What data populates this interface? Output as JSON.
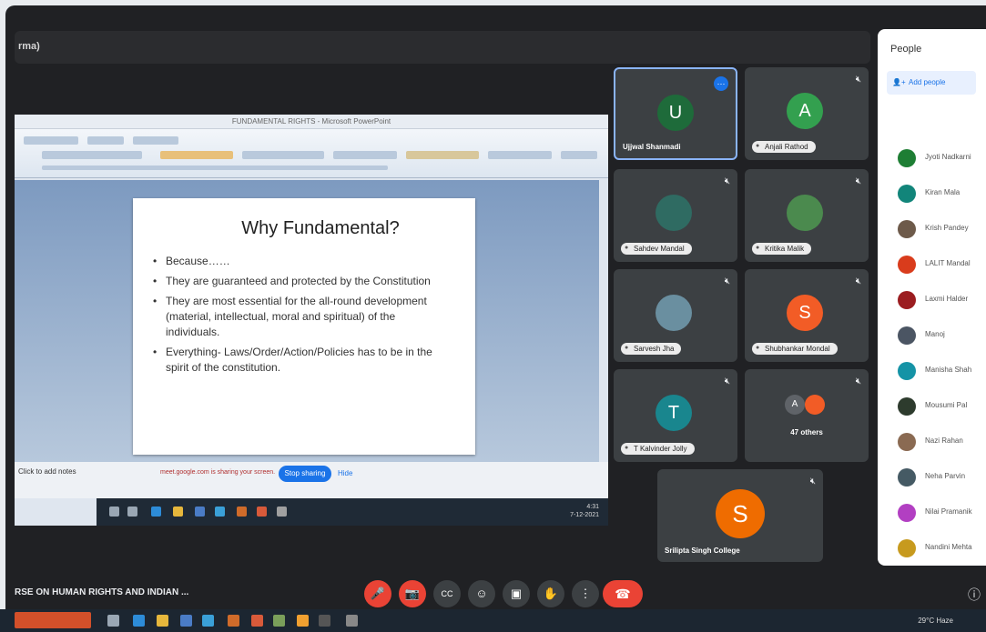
{
  "meeting": {
    "top_label": "rma)",
    "title": "RSE ON HUMAN RIGHTS AND INDIAN ..."
  },
  "shared_screen": {
    "window_title": "FUNDAMENTAL RIGHTS - Microsoft PowerPoint",
    "slide": {
      "title": "Why Fundamental?",
      "bullets": [
        "Because……",
        "They are guaranteed and protected by the Constitution",
        "They are most essential for the all-round development (material, intellectual, moral and spiritual) of the individuals.",
        "Everything- Laws/Order/Action/Policies has to be in the spirit of the constitution."
      ]
    },
    "status_label": "Click to add notes",
    "share_notice": "meet.google.com is sharing your screen.",
    "stop_sharing_label": "Stop sharing",
    "hide_label": "Hide",
    "clock": [
      "4:31",
      "7-12-2021"
    ]
  },
  "tiles": [
    {
      "initial": "U",
      "name": "Ujjwal Shanmadi",
      "color": "#1e6b3a",
      "active": true,
      "style": "plain"
    },
    {
      "initial": "A",
      "name": "Anjali Rathod",
      "color": "#33a04f",
      "style": "chip"
    },
    {
      "initial": "",
      "name": "Sahdev Mandal",
      "color": "#2f6b62",
      "style": "chip",
      "photo": true
    },
    {
      "initial": "",
      "name": "Kritika Malik",
      "color": "#4b8a4e",
      "style": "chip",
      "photo": true
    },
    {
      "initial": "",
      "name": "Sarvesh Jha",
      "color": "#6a8fa0",
      "style": "chip",
      "photo": true
    },
    {
      "initial": "S",
      "name": "Shubhankar Mondal",
      "color": "#f25c26",
      "style": "chip"
    },
    {
      "initial": "T",
      "name": "T Kalvinder Jolly",
      "color": "#19868e",
      "style": "chip"
    },
    {
      "initial": "A",
      "name": "47 others",
      "color": "#5f6368",
      "style": "others"
    },
    {
      "initial": "S",
      "name": "Srilipta Singh College",
      "color": "#ef6c00",
      "style": "plain"
    }
  ],
  "people_panel": {
    "title": "People",
    "add_label": "Add people",
    "list": [
      {
        "name": "Jyoti Nadkarni",
        "color": "#1e7e34"
      },
      {
        "name": "Kiran Mala",
        "color": "#12857a"
      },
      {
        "name": "Krish Pandey",
        "color": "#6d5a4a"
      },
      {
        "name": "LALIT Mandal",
        "color": "#d93c1c"
      },
      {
        "name": "Laxmi Halder",
        "color": "#9b1d20"
      },
      {
        "name": "Manoj",
        "color": "#4b5563"
      },
      {
        "name": "Manisha Shah",
        "color": "#1593a6"
      },
      {
        "name": "Mousumi Pal",
        "color": "#2d3b2d"
      },
      {
        "name": "Nazi Rahan",
        "color": "#8a6a52"
      },
      {
        "name": "Neha Parvin",
        "color": "#455a64"
      },
      {
        "name": "Nilai Pramanik",
        "color": "#b23fc2"
      },
      {
        "name": "Nandini Mehta",
        "color": "#c79a1e"
      }
    ]
  },
  "controls": {
    "mic_off": "🎤",
    "cam_off": "📷",
    "captions": "CC",
    "emoji": "☺",
    "present": "▣",
    "hand": "✋",
    "more": "⋮",
    "end": "☎",
    "info": "ⓘ"
  },
  "host": {
    "weather": "29°C Haze"
  },
  "colors": {
    "meet_bg": "#202124",
    "tile_bg": "#3c4043",
    "accent": "#1a73e8",
    "danger": "#ea4335"
  }
}
